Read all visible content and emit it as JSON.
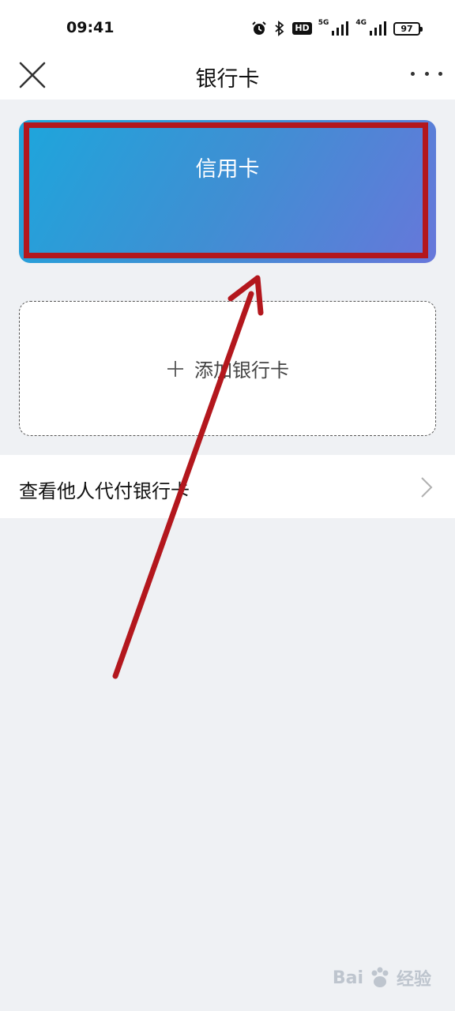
{
  "status_bar": {
    "time": "09:41",
    "hd_label": "HD",
    "net_5g": "5G",
    "net_4g": "4G",
    "battery": "97"
  },
  "nav": {
    "title": "银行卡",
    "close_icon": "close-icon",
    "more_icon": "more-icon"
  },
  "credit_card": {
    "label": "信用卡",
    "gradient_start": "#1da6dc",
    "gradient_end": "#6777da"
  },
  "add_card": {
    "label": "添加银行卡",
    "icon": "plus-icon"
  },
  "list": {
    "items": [
      {
        "label": "查看他人代付银行卡",
        "icon": "chevron-right-icon"
      }
    ]
  },
  "annotation": {
    "color": "#b3171d"
  },
  "watermark": {
    "text": "Bai",
    "text_suffix": "经验"
  }
}
